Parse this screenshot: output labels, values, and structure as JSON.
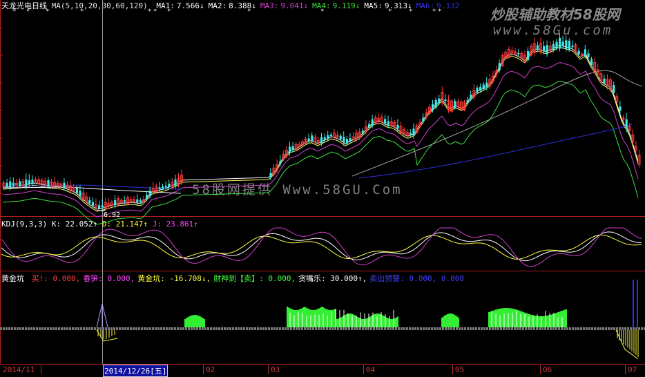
{
  "main_panel": {
    "stock_name": "天龙光电",
    "period": "日线",
    "ma_params": "MA(5,10,20,30,60,120)",
    "ma_items": [
      {
        "label": "MA1:",
        "value": "7.566↓",
        "color": "#ffffff"
      },
      {
        "label": "MA2:",
        "value": "8.388↓",
        "color": "#ffffff"
      },
      {
        "label": "MA3:",
        "value": "9.041↓",
        "color": "#d040d0"
      },
      {
        "label": "MA4:",
        "value": "9.119↓",
        "color": "#40e040"
      },
      {
        "label": "MA5:",
        "value": "9.313↓",
        "color": "#ffffff"
      },
      {
        "label": "MA6:",
        "value": "9.132",
        "color": "#3030e0"
      }
    ],
    "low_marker": "6.92",
    "watermark_top": "炒股辅助教材58股网",
    "watermark_url": "www.58Gu.com",
    "watermark_center": "58股网提供 Www.58GU.Com"
  },
  "kdj_panel": {
    "title": "KDJ(9,3,3)",
    "k": "K: 22.052↑",
    "d": "D: 21.147↑",
    "j": "J: 23.861↑"
  },
  "indicator_panel": {
    "title": "黄金坑",
    "items": [
      {
        "text": "买!: 0.000,",
        "color": "#ff4040"
      },
      {
        "text": "春笋: 0.000,",
        "color": "#ff40ff"
      },
      {
        "text": "黄金坑: -16.708↓,",
        "color": "#ffff40"
      },
      {
        "text": "财神到【卖】: 0.000,",
        "color": "#40ff40"
      },
      {
        "text": "贪嘴乐: 30.000↑,",
        "color": "#ffffff"
      },
      {
        "text": "卖出预警: 0.000, 0.000",
        "color": "#4040ff"
      }
    ]
  },
  "x_axis": {
    "labels": [
      "2014/11",
      "2014/12/26[五]",
      "02",
      "03",
      "04",
      "05",
      "06",
      "07"
    ]
  },
  "colors": {
    "up": "#ff3b3b",
    "down": "#40e8e8",
    "grid": "#8b1a1a",
    "ma1": "#ffffff",
    "ma2": "#ffff60",
    "ma3": "#d040d0",
    "ma4": "#40e040",
    "ma5": "#a0a0a0",
    "ma6": "#3030e0",
    "hist": "#33ee33"
  }
}
